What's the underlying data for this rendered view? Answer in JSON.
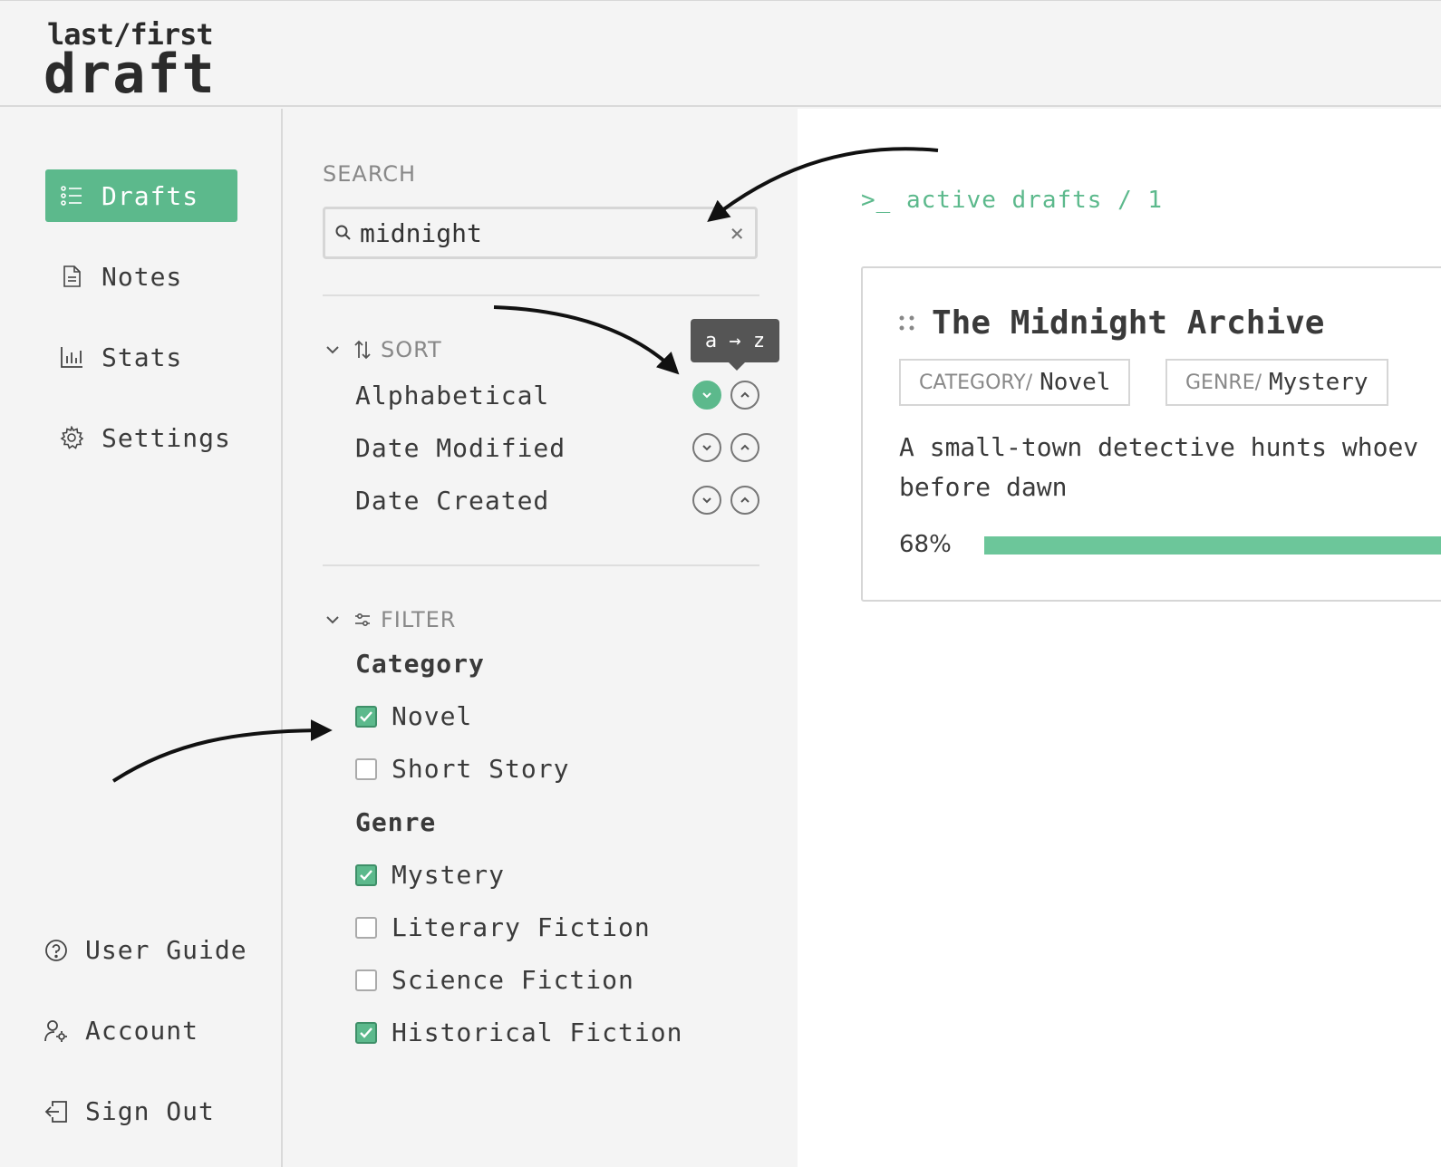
{
  "app": {
    "logo_top": "last/first",
    "logo_main": "draft"
  },
  "sidebar": {
    "items": [
      {
        "label": "Drafts",
        "icon": "list-icon",
        "active": true
      },
      {
        "label": "Notes",
        "icon": "document-icon",
        "active": false
      },
      {
        "label": "Stats",
        "icon": "bar-chart-icon",
        "active": false
      },
      {
        "label": "Settings",
        "icon": "gear-icon",
        "active": false
      }
    ],
    "bottom": [
      {
        "label": "User Guide",
        "icon": "help-circle-icon"
      },
      {
        "label": "Account",
        "icon": "user-gear-icon"
      },
      {
        "label": "Sign Out",
        "icon": "logout-icon"
      }
    ]
  },
  "search": {
    "label": "SEARCH",
    "value": "midnight",
    "clear": "×"
  },
  "sort": {
    "label": "SORT",
    "tooltip": "a → z",
    "options": [
      {
        "label": "Alphabetical",
        "desc_active": true
      },
      {
        "label": "Date Modified",
        "desc_active": false
      },
      {
        "label": "Date Created",
        "desc_active": false
      }
    ]
  },
  "filter": {
    "label": "FILTER",
    "groups": [
      {
        "title": "Category",
        "options": [
          {
            "label": "Novel",
            "checked": true
          },
          {
            "label": "Short Story",
            "checked": false
          }
        ]
      },
      {
        "title": "Genre",
        "options": [
          {
            "label": "Mystery",
            "checked": true
          },
          {
            "label": "Literary Fiction",
            "checked": false
          },
          {
            "label": "Science Fiction",
            "checked": false
          },
          {
            "label": "Historical Fiction",
            "checked": true
          }
        ]
      }
    ]
  },
  "main": {
    "breadcrumb": ">_ active drafts / 1",
    "card": {
      "title": "The Midnight Archive",
      "tags": [
        {
          "key": "CATEGORY/",
          "value": "Novel"
        },
        {
          "key": "GENRE/",
          "value": "Mystery"
        }
      ],
      "summary_line1": "A small-town detective hunts whoev",
      "summary_line2": "before dawn",
      "progress_label": "68%",
      "progress": 0.68
    }
  },
  "colors": {
    "accent": "#5cb98c",
    "text": "#3a3a3a",
    "muted": "#888888",
    "panel_bg": "#f4f4f4"
  }
}
